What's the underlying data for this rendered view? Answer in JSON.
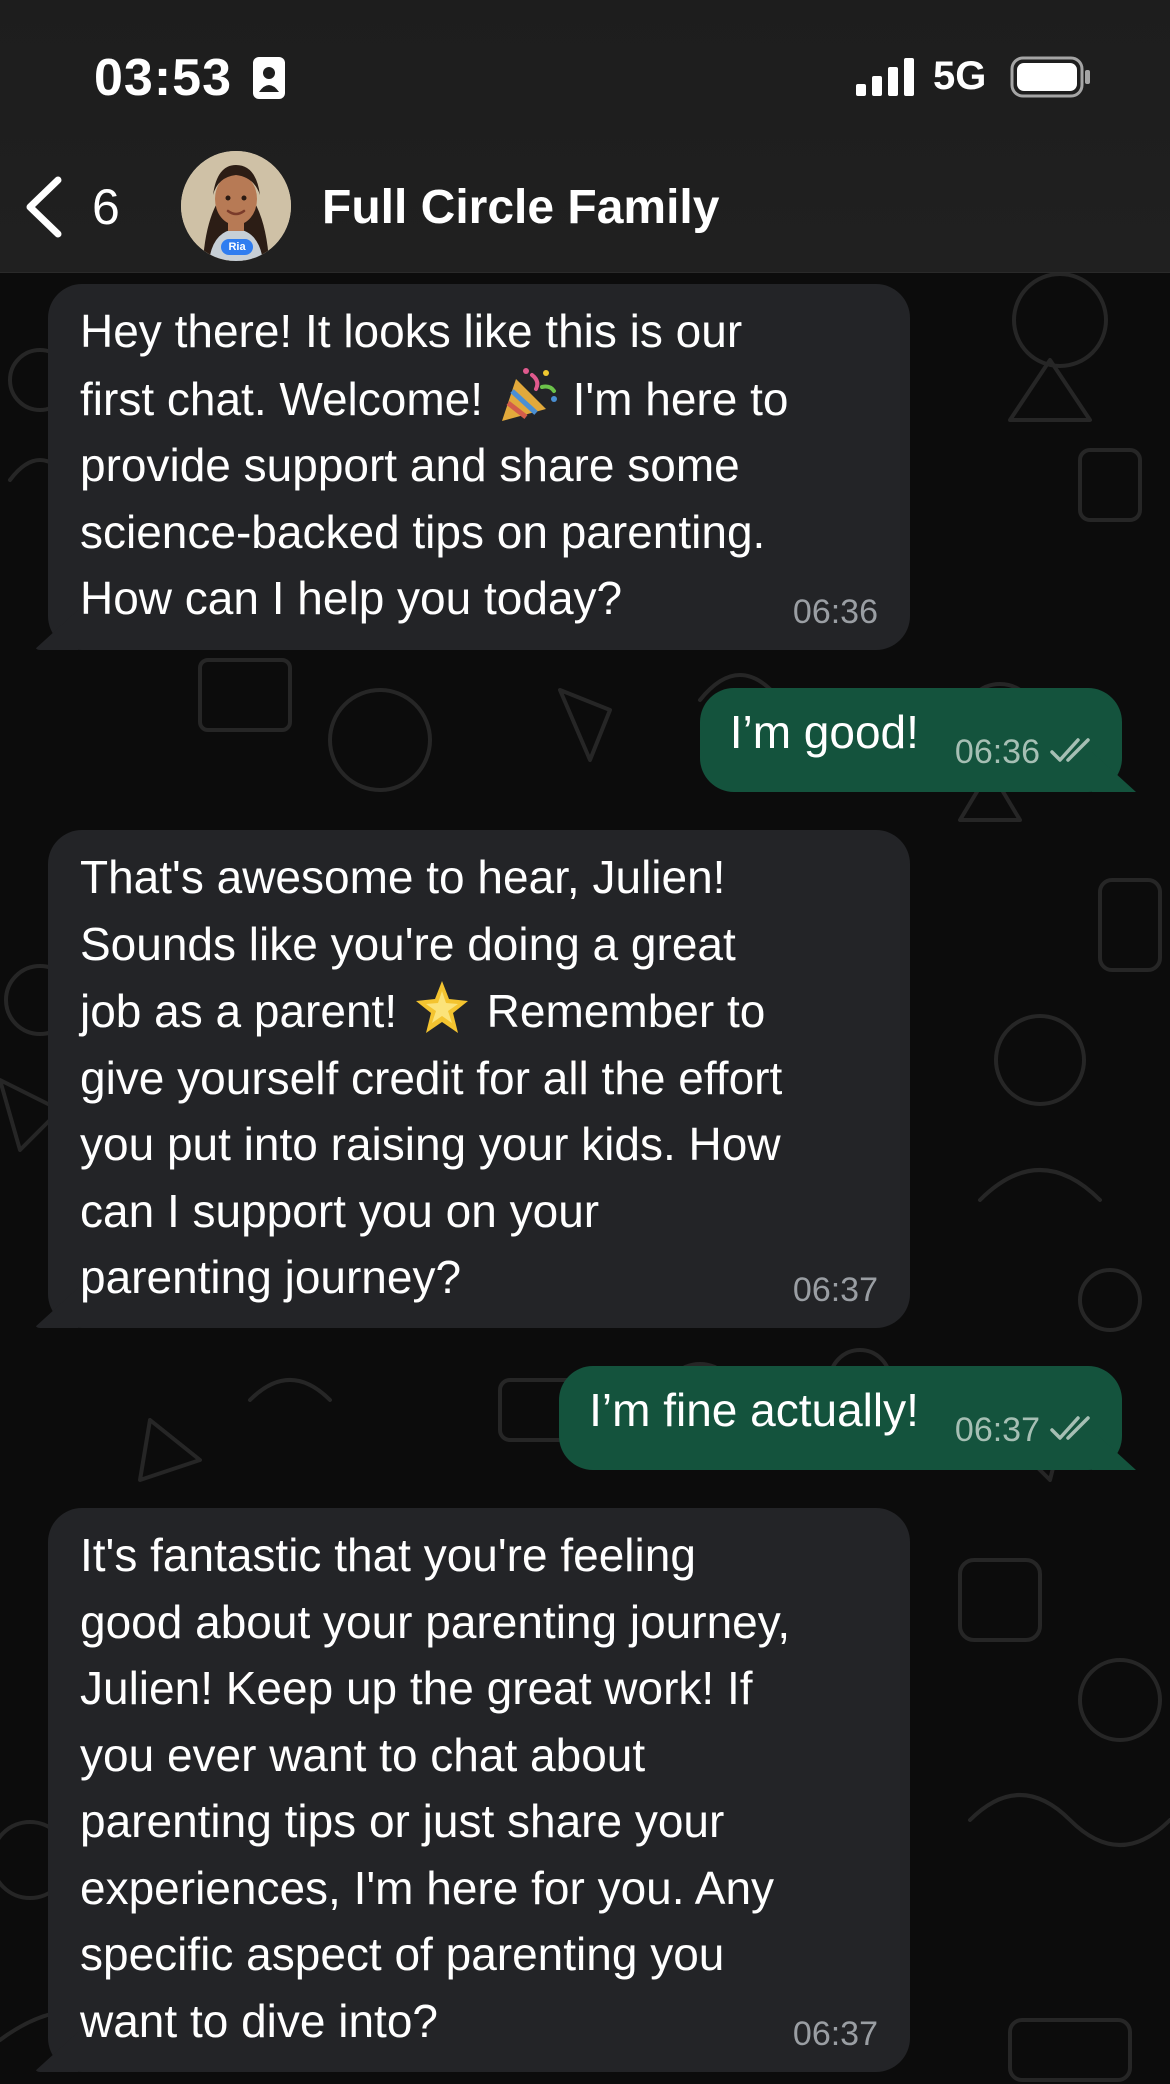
{
  "status_bar": {
    "time": "03:53",
    "network": "5G",
    "icons": [
      "contact-card-icon",
      "signal-bars-icon",
      "battery-icon"
    ]
  },
  "header": {
    "back_count": "6",
    "avatar_label": "Ria",
    "title": "Full Circle Family",
    "icons": [
      "chevron-left-icon"
    ]
  },
  "messages": [
    {
      "direction": "incoming",
      "parts": [
        "Hey there! It looks like this is our\nfirst chat. Welcome! ",
        " I'm here to\nprovide support and share some\nscience-backed tips on parenting.\nHow can I help you today?"
      ],
      "emoji": "party-popper-icon",
      "time": "06:36"
    },
    {
      "direction": "outgoing",
      "text": "I’m good!",
      "time": "06:36",
      "status": "read"
    },
    {
      "direction": "incoming",
      "parts": [
        "That's awesome to hear, Julien!\nSounds like you're doing a great\njob as a parent! ",
        " Remember to\ngive yourself credit for all the effort\nyou put into raising your kids. How\ncan I support you on your\nparenting journey?"
      ],
      "emoji": "glowing-star-icon",
      "time": "06:37"
    },
    {
      "direction": "outgoing",
      "text": "I’m fine actually!",
      "time": "06:37",
      "status": "read"
    },
    {
      "direction": "incoming",
      "text": "It's fantastic that you're feeling\ngood about your parenting journey,\nJulien! Keep up the great work! If\nyou ever want to chat about\nparenting tips or just share your\nexperiences, I'm here for you. Any\nspecific aspect of parenting you\nwant to dive into?",
      "time": "06:37"
    }
  ],
  "colors": {
    "header_bg": "#1f1f1f",
    "incoming_bubble": "#232427",
    "outgoing_bubble": "#14533d",
    "timestamp": "#9a9ea3",
    "read_ticks": "#a6bfb4"
  }
}
